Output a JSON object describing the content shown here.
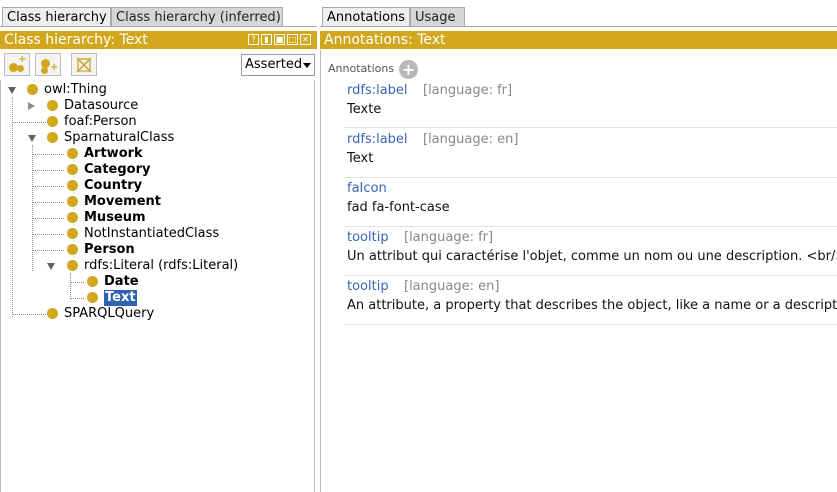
{
  "left_tabs": [
    "Class hierarchy",
    "Class hierarchy (inferred)"
  ],
  "right_tabs": [
    "Annotations",
    "Usage"
  ],
  "left_title": "Class hierarchy: Text",
  "right_title": "Annotations: Text",
  "title_buttons": [
    "?",
    "▮",
    "■",
    "□",
    "✕"
  ],
  "toolbar": {
    "add_subclass_icon": "add-subclass-icon",
    "add_sibling_icon": "add-sibling-icon",
    "delete_class_icon": "delete-class-icon",
    "mode": "Asserted"
  },
  "tree": {
    "owl_thing": "owl:Thing",
    "datasource": "Datasource",
    "foaf_person": "foaf:Person",
    "sparnatural_class": "SparnaturalClass",
    "artwork": "Artwork",
    "category": "Category",
    "country": "Country",
    "movement": "Movement",
    "museum": "Museum",
    "not_instantiated": "NotInstantiatedClass",
    "person": "Person",
    "rdfs_literal": "rdfs:Literal (rdfs:Literal)",
    "date": "Date",
    "text": "Text",
    "sparql_query": "SPARQLQuery"
  },
  "annotations_header": "Annotations",
  "annotations": [
    {
      "property": "rdfs:label",
      "language": "[language: fr]",
      "value": "Texte"
    },
    {
      "property": "rdfs:label",
      "language": "[language: en]",
      "value": "Text"
    },
    {
      "property": "faIcon",
      "language": "",
      "value": "fad fa-font-case"
    },
    {
      "property": "tooltip",
      "language": "[language: fr]",
      "value": "Un attribut qui caractérise l'objet, comme un nom ou une description. <br/><<"
    },
    {
      "property": "tooltip",
      "language": "[language: en]",
      "value": "An attribute, a property that describes the object, like a name or a description"
    }
  ],
  "colors": {
    "accent": "#d2a71e",
    "link": "#3667b5",
    "selection": "#2c64b2"
  }
}
